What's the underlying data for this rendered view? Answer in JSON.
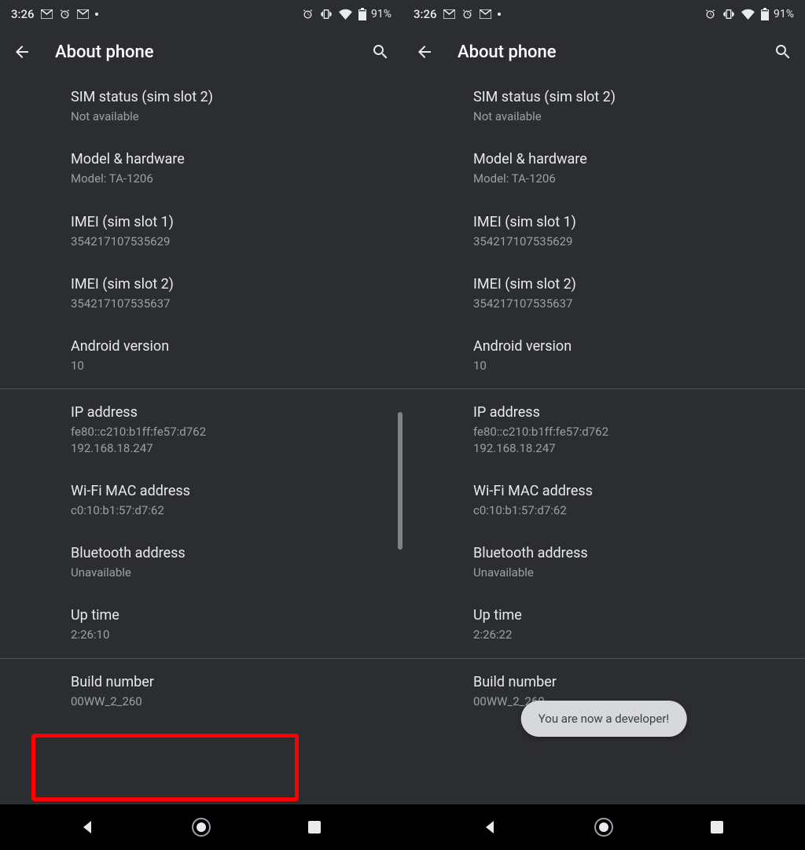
{
  "left": {
    "status": {
      "time": "3:26",
      "battery": "91%"
    },
    "header": {
      "title": "About phone"
    },
    "items": [
      {
        "title": "SIM status (sim slot 2)",
        "sub": "Not available"
      },
      {
        "title": "Model & hardware",
        "sub": "Model: TA-1206"
      },
      {
        "title": "IMEI (sim slot 1)",
        "sub": "354217107535629"
      },
      {
        "title": "IMEI (sim slot 2)",
        "sub": "354217107535637"
      },
      {
        "title": "Android version",
        "sub": "10"
      },
      {
        "title": "IP address",
        "sub": "fe80::c210:b1ff:fe57:d762\n192.168.18.247"
      },
      {
        "title": "Wi-Fi MAC address",
        "sub": "c0:10:b1:57:d7:62"
      },
      {
        "title": "Bluetooth address",
        "sub": "Unavailable"
      },
      {
        "title": "Up time",
        "sub": "2:26:10"
      },
      {
        "title": "Build number",
        "sub": "00WW_2_260"
      }
    ]
  },
  "right": {
    "status": {
      "time": "3:26",
      "battery": "91%"
    },
    "header": {
      "title": "About phone"
    },
    "items": [
      {
        "title": "SIM status (sim slot 2)",
        "sub": "Not available"
      },
      {
        "title": "Model & hardware",
        "sub": "Model: TA-1206"
      },
      {
        "title": "IMEI (sim slot 1)",
        "sub": "354217107535629"
      },
      {
        "title": "IMEI (sim slot 2)",
        "sub": "354217107535637"
      },
      {
        "title": "Android version",
        "sub": "10"
      },
      {
        "title": "IP address",
        "sub": "fe80::c210:b1ff:fe57:d762\n192.168.18.247"
      },
      {
        "title": "Wi-Fi MAC address",
        "sub": "c0:10:b1:57:d7:62"
      },
      {
        "title": "Bluetooth address",
        "sub": "Unavailable"
      },
      {
        "title": "Up time",
        "sub": "2:26:22"
      },
      {
        "title": "Build number",
        "sub": "00WW_2_260"
      }
    ],
    "toast": "You are now a developer!"
  }
}
